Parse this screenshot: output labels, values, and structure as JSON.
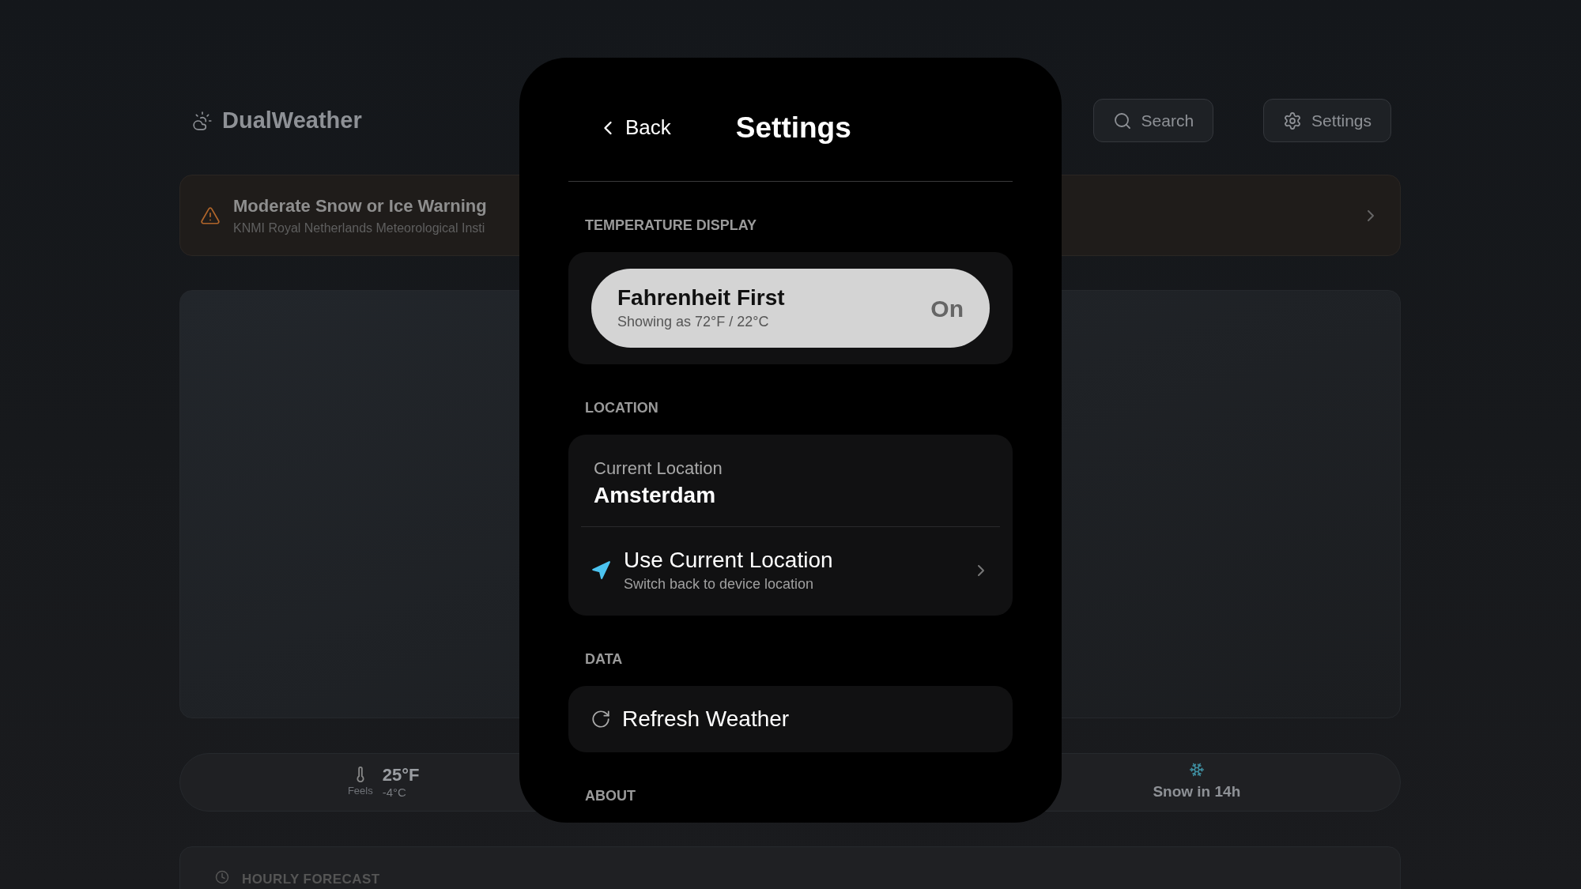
{
  "app": {
    "name": "DualWeather"
  },
  "header_buttons": [
    {
      "kind": "search",
      "label": "Search"
    },
    {
      "kind": "settings",
      "label": "Settings"
    }
  ],
  "alert": {
    "title": "Moderate Snow or Ice Warning",
    "source": "KNMI Royal Netherlands Meteorological Insti"
  },
  "summary": [
    {
      "kind": "feels",
      "label": "Feels",
      "primary": "25°F",
      "secondary": "-4°C"
    },
    {
      "kind": "snow",
      "text": "Snow in 14h"
    }
  ],
  "hourly": {
    "title": "HOURLY FORECAST"
  },
  "settings": {
    "back": "Back",
    "title": "Settings",
    "sections": [
      {
        "title": "TEMPERATURE DISPLAY",
        "items": [
          {
            "kind": "toggle",
            "title": "Fahrenheit First",
            "subtitle": "Showing as 72°F / 22°C",
            "on": true,
            "state_label": "On"
          }
        ]
      },
      {
        "title": "LOCATION",
        "items": [
          {
            "kind": "info",
            "label": "Current Location",
            "value": "Amsterdam"
          },
          {
            "kind": "link",
            "title": "Use Current Location",
            "subtitle": "Switch back to device location"
          }
        ]
      },
      {
        "title": "DATA",
        "items": [
          {
            "kind": "action",
            "title": "Refresh Weather"
          }
        ]
      },
      {
        "title": "ABOUT"
      }
    ]
  }
}
